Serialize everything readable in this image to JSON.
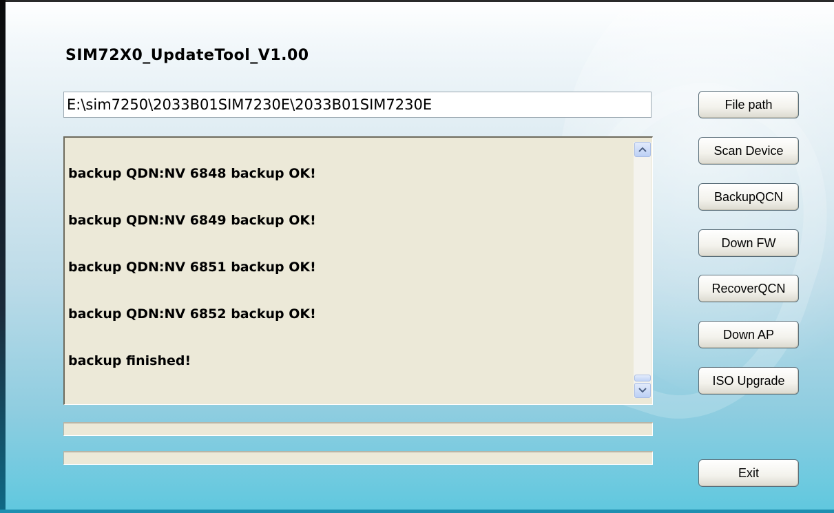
{
  "window": {
    "title": "SIM72X0_UpdateTool_V1.00"
  },
  "file_path": {
    "value": "E:\\sim7250\\2033B01SIM7230E\\2033B01SIM7230E"
  },
  "log": {
    "lines": [
      "backup QDN:NV 6848 backup OK!",
      "backup QDN:NV 6849 backup OK!",
      "backup QDN:NV 6851 backup OK!",
      "backup QDN:NV 6852 backup OK!",
      "backup finished!"
    ]
  },
  "progress": {
    "bar1": 0,
    "bar2": 0
  },
  "buttons": {
    "file_path": "File path",
    "scan_device": "Scan Device",
    "backup_qcn": "BackupQCN",
    "down_fw": "Down FW",
    "recover_qcn": "RecoverQCN",
    "down_ap": "Down AP",
    "iso_upgrade": "ISO Upgrade",
    "exit": "Exit"
  },
  "icons": {
    "scroll_up": "chevron-up-icon",
    "scroll_down": "chevron-down-icon"
  },
  "colors": {
    "log_background": "#ece9d8",
    "window_gradient_bottom": "#5fc8df"
  }
}
